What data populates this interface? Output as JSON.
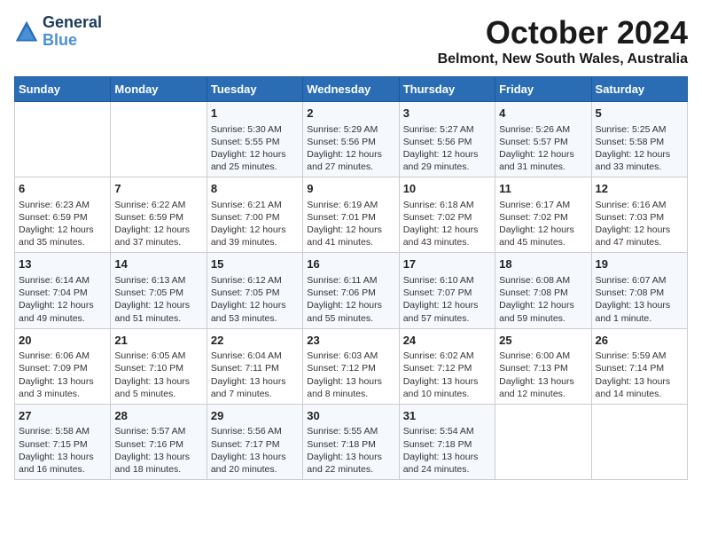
{
  "logo": {
    "line1": "General",
    "line2": "Blue"
  },
  "title": "October 2024",
  "location": "Belmont, New South Wales, Australia",
  "days_of_week": [
    "Sunday",
    "Monday",
    "Tuesday",
    "Wednesday",
    "Thursday",
    "Friday",
    "Saturday"
  ],
  "weeks": [
    [
      {
        "day": "",
        "sunrise": "",
        "sunset": "",
        "daylight": ""
      },
      {
        "day": "",
        "sunrise": "",
        "sunset": "",
        "daylight": ""
      },
      {
        "day": "1",
        "sunrise": "Sunrise: 5:30 AM",
        "sunset": "Sunset: 5:55 PM",
        "daylight": "Daylight: 12 hours and 25 minutes."
      },
      {
        "day": "2",
        "sunrise": "Sunrise: 5:29 AM",
        "sunset": "Sunset: 5:56 PM",
        "daylight": "Daylight: 12 hours and 27 minutes."
      },
      {
        "day": "3",
        "sunrise": "Sunrise: 5:27 AM",
        "sunset": "Sunset: 5:56 PM",
        "daylight": "Daylight: 12 hours and 29 minutes."
      },
      {
        "day": "4",
        "sunrise": "Sunrise: 5:26 AM",
        "sunset": "Sunset: 5:57 PM",
        "daylight": "Daylight: 12 hours and 31 minutes."
      },
      {
        "day": "5",
        "sunrise": "Sunrise: 5:25 AM",
        "sunset": "Sunset: 5:58 PM",
        "daylight": "Daylight: 12 hours and 33 minutes."
      }
    ],
    [
      {
        "day": "6",
        "sunrise": "Sunrise: 6:23 AM",
        "sunset": "Sunset: 6:59 PM",
        "daylight": "Daylight: 12 hours and 35 minutes."
      },
      {
        "day": "7",
        "sunrise": "Sunrise: 6:22 AM",
        "sunset": "Sunset: 6:59 PM",
        "daylight": "Daylight: 12 hours and 37 minutes."
      },
      {
        "day": "8",
        "sunrise": "Sunrise: 6:21 AM",
        "sunset": "Sunset: 7:00 PM",
        "daylight": "Daylight: 12 hours and 39 minutes."
      },
      {
        "day": "9",
        "sunrise": "Sunrise: 6:19 AM",
        "sunset": "Sunset: 7:01 PM",
        "daylight": "Daylight: 12 hours and 41 minutes."
      },
      {
        "day": "10",
        "sunrise": "Sunrise: 6:18 AM",
        "sunset": "Sunset: 7:02 PM",
        "daylight": "Daylight: 12 hours and 43 minutes."
      },
      {
        "day": "11",
        "sunrise": "Sunrise: 6:17 AM",
        "sunset": "Sunset: 7:02 PM",
        "daylight": "Daylight: 12 hours and 45 minutes."
      },
      {
        "day": "12",
        "sunrise": "Sunrise: 6:16 AM",
        "sunset": "Sunset: 7:03 PM",
        "daylight": "Daylight: 12 hours and 47 minutes."
      }
    ],
    [
      {
        "day": "13",
        "sunrise": "Sunrise: 6:14 AM",
        "sunset": "Sunset: 7:04 PM",
        "daylight": "Daylight: 12 hours and 49 minutes."
      },
      {
        "day": "14",
        "sunrise": "Sunrise: 6:13 AM",
        "sunset": "Sunset: 7:05 PM",
        "daylight": "Daylight: 12 hours and 51 minutes."
      },
      {
        "day": "15",
        "sunrise": "Sunrise: 6:12 AM",
        "sunset": "Sunset: 7:05 PM",
        "daylight": "Daylight: 12 hours and 53 minutes."
      },
      {
        "day": "16",
        "sunrise": "Sunrise: 6:11 AM",
        "sunset": "Sunset: 7:06 PM",
        "daylight": "Daylight: 12 hours and 55 minutes."
      },
      {
        "day": "17",
        "sunrise": "Sunrise: 6:10 AM",
        "sunset": "Sunset: 7:07 PM",
        "daylight": "Daylight: 12 hours and 57 minutes."
      },
      {
        "day": "18",
        "sunrise": "Sunrise: 6:08 AM",
        "sunset": "Sunset: 7:08 PM",
        "daylight": "Daylight: 12 hours and 59 minutes."
      },
      {
        "day": "19",
        "sunrise": "Sunrise: 6:07 AM",
        "sunset": "Sunset: 7:08 PM",
        "daylight": "Daylight: 13 hours and 1 minute."
      }
    ],
    [
      {
        "day": "20",
        "sunrise": "Sunrise: 6:06 AM",
        "sunset": "Sunset: 7:09 PM",
        "daylight": "Daylight: 13 hours and 3 minutes."
      },
      {
        "day": "21",
        "sunrise": "Sunrise: 6:05 AM",
        "sunset": "Sunset: 7:10 PM",
        "daylight": "Daylight: 13 hours and 5 minutes."
      },
      {
        "day": "22",
        "sunrise": "Sunrise: 6:04 AM",
        "sunset": "Sunset: 7:11 PM",
        "daylight": "Daylight: 13 hours and 7 minutes."
      },
      {
        "day": "23",
        "sunrise": "Sunrise: 6:03 AM",
        "sunset": "Sunset: 7:12 PM",
        "daylight": "Daylight: 13 hours and 8 minutes."
      },
      {
        "day": "24",
        "sunrise": "Sunrise: 6:02 AM",
        "sunset": "Sunset: 7:12 PM",
        "daylight": "Daylight: 13 hours and 10 minutes."
      },
      {
        "day": "25",
        "sunrise": "Sunrise: 6:00 AM",
        "sunset": "Sunset: 7:13 PM",
        "daylight": "Daylight: 13 hours and 12 minutes."
      },
      {
        "day": "26",
        "sunrise": "Sunrise: 5:59 AM",
        "sunset": "Sunset: 7:14 PM",
        "daylight": "Daylight: 13 hours and 14 minutes."
      }
    ],
    [
      {
        "day": "27",
        "sunrise": "Sunrise: 5:58 AM",
        "sunset": "Sunset: 7:15 PM",
        "daylight": "Daylight: 13 hours and 16 minutes."
      },
      {
        "day": "28",
        "sunrise": "Sunrise: 5:57 AM",
        "sunset": "Sunset: 7:16 PM",
        "daylight": "Daylight: 13 hours and 18 minutes."
      },
      {
        "day": "29",
        "sunrise": "Sunrise: 5:56 AM",
        "sunset": "Sunset: 7:17 PM",
        "daylight": "Daylight: 13 hours and 20 minutes."
      },
      {
        "day": "30",
        "sunrise": "Sunrise: 5:55 AM",
        "sunset": "Sunset: 7:18 PM",
        "daylight": "Daylight: 13 hours and 22 minutes."
      },
      {
        "day": "31",
        "sunrise": "Sunrise: 5:54 AM",
        "sunset": "Sunset: 7:18 PM",
        "daylight": "Daylight: 13 hours and 24 minutes."
      },
      {
        "day": "",
        "sunrise": "",
        "sunset": "",
        "daylight": ""
      },
      {
        "day": "",
        "sunrise": "",
        "sunset": "",
        "daylight": ""
      }
    ]
  ]
}
